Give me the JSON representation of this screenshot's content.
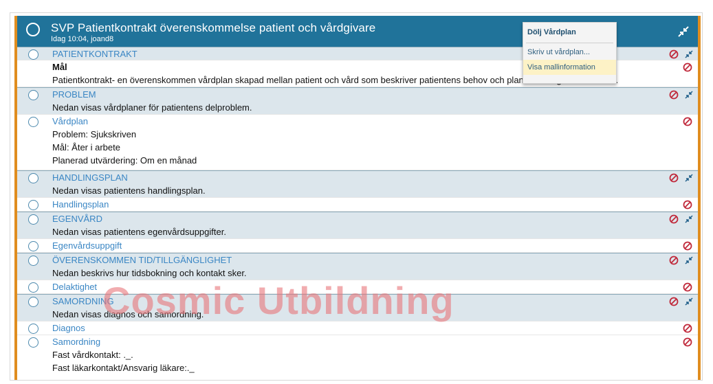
{
  "header": {
    "title": "SVP Patientkontrakt överenskommelse patient och vårdgivare",
    "subtitle": "Idag 10:04, joand8"
  },
  "menu": {
    "items": [
      "Dölj Vårdplan",
      "Skriv ut vårdplan...",
      "Visa mallinformation"
    ]
  },
  "rows": [
    {
      "label": "PATIENTKONTRAKT",
      "lines": [
        "Mål",
        "Patientkontrakt- en överenskommen vårdplan skapad mellan patient och vård som beskriver patientens behov och planerade åtgärder/insatser."
      ]
    },
    {
      "label": "PROBLEM",
      "lines": [
        "Nedan visas vårdplaner för patientens delproblem."
      ]
    },
    {
      "label": "Vårdplan",
      "lines": [
        "Problem: Sjukskriven",
        "Mål: Åter i arbete",
        "Planerad utvärdering: Om en månad"
      ]
    },
    {
      "label": "HANDLINGSPLAN",
      "lines": [
        "Nedan visas patientens handlingsplan."
      ]
    },
    {
      "label": "Handlingsplan",
      "lines": []
    },
    {
      "label": "EGENVÅRD",
      "lines": [
        "Nedan visas patientens egenvårdsuppgifter."
      ]
    },
    {
      "label": "Egenvårdsuppgift",
      "lines": []
    },
    {
      "label": "ÖVERENSKOMMEN TID/TILLGÄNGLIGHET",
      "lines": [
        "Nedan beskrivs hur tidsbokning och kontakt sker."
      ]
    },
    {
      "label": "Delaktighet",
      "lines": []
    },
    {
      "label": "SAMORDNING",
      "lines": [
        "Nedan visas diagnos och samordning."
      ]
    },
    {
      "label": "Diagnos",
      "lines": []
    },
    {
      "label": "Samordning",
      "lines": [
        "Fast vårdkontakt: ._.",
        "Fast läkarkontakt/Ansvarig läkare:._"
      ]
    }
  ],
  "watermark": "Cosmic Utbildning",
  "colors": {
    "header": "#20739a",
    "accent_border": "#e08d1f",
    "link": "#3a86c4",
    "section_bg": "#dce6ec"
  }
}
